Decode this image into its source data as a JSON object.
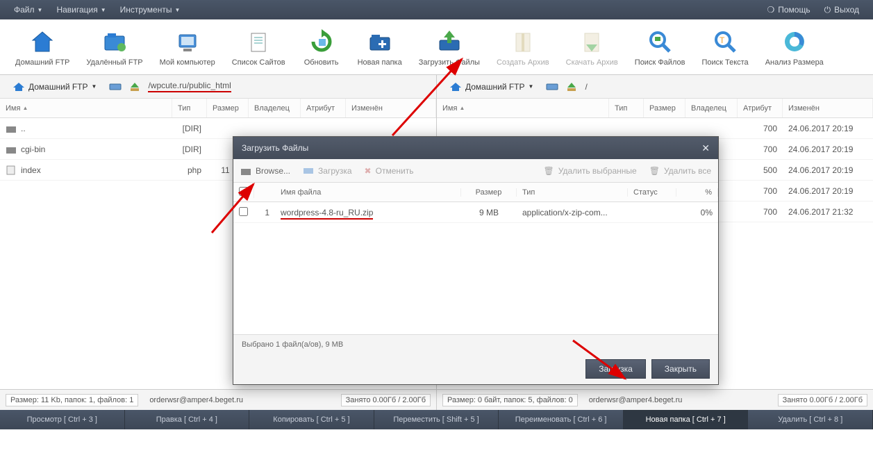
{
  "menubar": {
    "items": [
      "Файл",
      "Навигация",
      "Инструменты"
    ],
    "help": "Помощь",
    "exit": "Выход"
  },
  "toolbar": {
    "items": [
      {
        "label": "Домашний FTP",
        "icon": "home"
      },
      {
        "label": "Удалённый FTP",
        "icon": "remote"
      },
      {
        "label": "Мой компьютер",
        "icon": "computer"
      },
      {
        "label": "Список Сайтов",
        "icon": "sitelist"
      },
      {
        "label": "Обновить",
        "icon": "refresh"
      },
      {
        "label": "Новая папка",
        "icon": "newfolder"
      },
      {
        "label": "Загрузить Файлы",
        "icon": "upload"
      },
      {
        "label": "Создать Архив",
        "icon": "archive",
        "disabled": true
      },
      {
        "label": "Скачать Архив",
        "icon": "download",
        "disabled": true
      },
      {
        "label": "Поиск Файлов",
        "icon": "searchfile"
      },
      {
        "label": "Поиск Текста",
        "icon": "searchtext"
      },
      {
        "label": "Анализ Размера",
        "icon": "size"
      }
    ]
  },
  "columns": {
    "name": "Имя",
    "type": "Тип",
    "size": "Размер",
    "owner": "Владелец",
    "attr": "Атрибут",
    "mod": "Изменён"
  },
  "left": {
    "loc_label": "Домашний FTP",
    "path": "/wpcute.ru/public_html",
    "rows": [
      {
        "name": "..",
        "type": "[DIR]",
        "size": "",
        "owner": "",
        "attr": "",
        "mod": "",
        "icon": "folder-up"
      },
      {
        "name": "cgi-bin",
        "type": "[DIR]",
        "size": "",
        "owner": "",
        "attr": "",
        "mod": "",
        "icon": "folder"
      },
      {
        "name": "index",
        "type": "php",
        "size": "11 KB",
        "owner": "",
        "attr": "",
        "mod": "",
        "icon": "file"
      }
    ]
  },
  "right": {
    "loc_label": "Домашний FTP",
    "path": "/",
    "rows": [
      {
        "attr": "700",
        "mod": "24.06.2017 20:19"
      },
      {
        "attr": "700",
        "mod": "24.06.2017 20:19"
      },
      {
        "attr": "500",
        "mod": "24.06.2017 20:19"
      },
      {
        "attr": "700",
        "mod": "24.06.2017 20:19"
      },
      {
        "attr": "700",
        "mod": "24.06.2017 21:32"
      }
    ]
  },
  "status": {
    "left_summary": "Размер: 11 Kb, папок: 1, файлов: 1",
    "left_user": "orderwsr@amper4.beget.ru",
    "left_space": "Занято 0.00Гб / 2.00Гб",
    "right_summary": "Размер: 0 байт, папок: 5, файлов: 0",
    "right_user": "orderwsr@amper4.beget.ru",
    "right_space": "Занято 0.00Гб / 2.00Гб"
  },
  "bottombar": {
    "items": [
      "Просмотр [ Ctrl + 3 ]",
      "Правка [ Ctrl + 4 ]",
      "Копировать [ Ctrl + 5 ]",
      "Переместить [ Shift + 5 ]",
      "Переименовать [ Ctrl + 6 ]",
      "Новая папка [ Ctrl + 7 ]",
      "Удалить [ Ctrl + 8 ]"
    ],
    "active_index": 5
  },
  "dialog": {
    "title": "Загрузить Файлы",
    "browse": "Browse...",
    "upload": "Загрузка",
    "cancel": "Отменить",
    "delete_selected": "Удалить выбранные",
    "delete_all": "Удалить все",
    "col_name": "Имя файла",
    "col_size": "Размер",
    "col_type": "Тип",
    "col_status": "Статус",
    "col_pct": "%",
    "rows": [
      {
        "num": "1",
        "name": "wordpress-4.8-ru_RU.zip",
        "size": "9 MB",
        "type": "application/x-zip-com...",
        "status": "",
        "pct": "0%"
      }
    ],
    "status_text": "Выбрано 1 файл(а/ов), 9 MB",
    "btn_upload": "Загрузка",
    "btn_close": "Закрыть"
  }
}
